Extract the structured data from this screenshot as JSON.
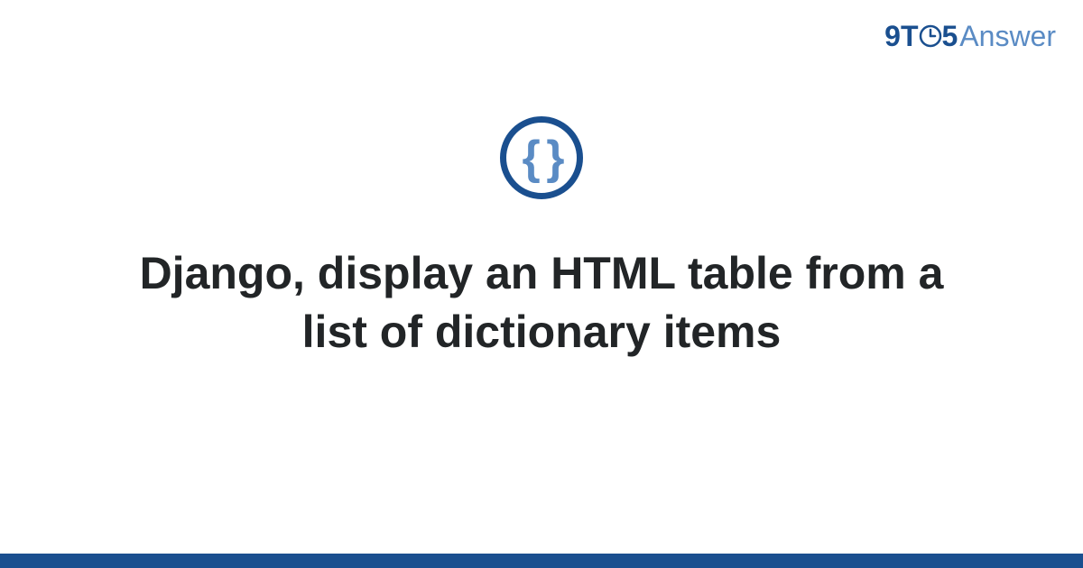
{
  "logo": {
    "part1": "9",
    "part2": "T",
    "part3": "5",
    "part4": "Answer"
  },
  "icon": {
    "braces": "{ }"
  },
  "title": "Django, display an HTML table from a list of dictionary items",
  "colors": {
    "primary": "#1a4f8f",
    "secondary": "#5a8bc4",
    "text": "#222527"
  }
}
